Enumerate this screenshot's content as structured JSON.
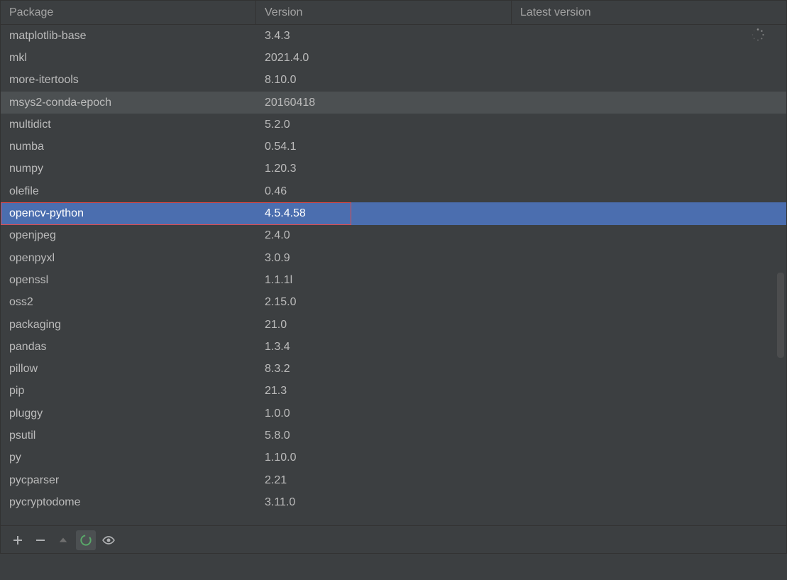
{
  "columns": {
    "package": "Package",
    "version": "Version",
    "latest": "Latest version"
  },
  "selected_index": 8,
  "hovered_index": 3,
  "highlight_selected_rect": true,
  "rows": [
    {
      "name": "matplotlib-base",
      "version": "3.4.3"
    },
    {
      "name": "mkl",
      "version": "2021.4.0"
    },
    {
      "name": "more-itertools",
      "version": "8.10.0"
    },
    {
      "name": "msys2-conda-epoch",
      "version": "20160418"
    },
    {
      "name": "multidict",
      "version": "5.2.0"
    },
    {
      "name": "numba",
      "version": "0.54.1"
    },
    {
      "name": "numpy",
      "version": "1.20.3"
    },
    {
      "name": "olefile",
      "version": "0.46"
    },
    {
      "name": "opencv-python",
      "version": "4.5.4.58"
    },
    {
      "name": "openjpeg",
      "version": "2.4.0"
    },
    {
      "name": "openpyxl",
      "version": "3.0.9"
    },
    {
      "name": "openssl",
      "version": "1.1.1l"
    },
    {
      "name": "oss2",
      "version": "2.15.0"
    },
    {
      "name": "packaging",
      "version": "21.0"
    },
    {
      "name": "pandas",
      "version": "1.3.4"
    },
    {
      "name": "pillow",
      "version": "8.3.2"
    },
    {
      "name": "pip",
      "version": "21.3"
    },
    {
      "name": "pluggy",
      "version": "1.0.0"
    },
    {
      "name": "psutil",
      "version": "5.8.0"
    },
    {
      "name": "py",
      "version": "1.10.0"
    },
    {
      "name": "pycparser",
      "version": "2.21"
    },
    {
      "name": "pycryptodome",
      "version": "3.11.0"
    }
  ],
  "toolbar": {
    "add": "+",
    "remove": "−",
    "upgrade": "▲",
    "refresh": "⟳",
    "view": "👁"
  }
}
